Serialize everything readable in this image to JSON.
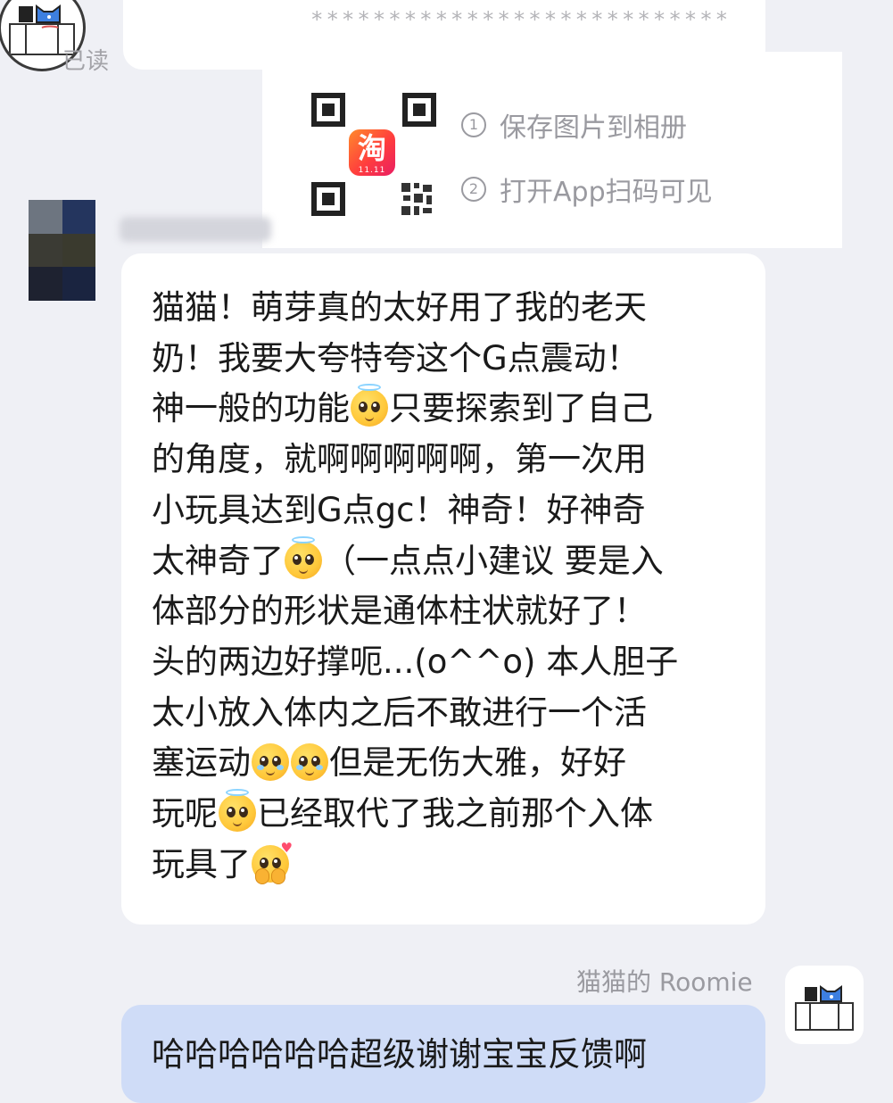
{
  "chat": {
    "read_status": "已读",
    "masked_text": "***************************",
    "share_card": {
      "logo_text": "淘",
      "logo_date": "11.11",
      "step1_num": "1",
      "step1": "保存图片到相册",
      "step2_num": "2",
      "step2": "打开App扫码可见"
    },
    "message_segments": [
      [
        "猫猫！萌芽真的太好用了我的老天"
      ],
      [
        "奶！我要大夸特夸这个G点震动！"
      ],
      [
        "神一般的功能",
        {
          "emoji": "angel-face-emoji"
        },
        "只要探索到了自己"
      ],
      [
        "的角度，就啊啊啊啊啊，第一次用"
      ],
      [
        "小玩具达到G点gc！神奇！好神奇"
      ],
      [
        "太神奇了",
        {
          "emoji": "angel-face-emoji"
        },
        "（一点点小建议 要是入"
      ],
      [
        "体部分的形状是通体柱状就好了！"
      ],
      [
        "头的两边好撑呃...(o^^o) 本人胆子"
      ],
      [
        "太小放入体内之后不敢进行一个活"
      ],
      [
        "塞运动",
        {
          "emoji": "pleading-face-emoji"
        },
        {
          "emoji": "pleading-face-emoji"
        },
        "但是无伤大雅，好好"
      ],
      [
        "玩呢",
        {
          "emoji": "angel-face-emoji"
        },
        "已经取代了我之前那个入体"
      ],
      [
        "玩具了",
        {
          "emoji": "blushing-hands-heart-emoji"
        }
      ]
    ],
    "own_name": "猫猫的 Roomie",
    "own_message": "哈哈哈哈哈哈超级谢谢宝宝反馈啊"
  },
  "colors": {
    "background": "#eff0f5",
    "bubble": "#ffffff",
    "own_bubble": "#cfdcf7",
    "meta_text": "#9a9aa0"
  }
}
